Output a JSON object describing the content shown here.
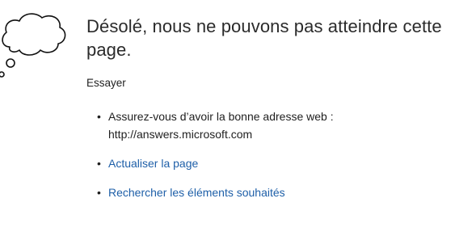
{
  "error": {
    "title": "Désolé, nous ne pouvons pas atteindre cette page.",
    "try_label": "Essayer",
    "suggestions": [
      {
        "text": "Assurez-vous d’avoir la bonne adresse web :",
        "url": "http://answers.microsoft.com"
      },
      {
        "link": "Actualiser la page"
      },
      {
        "link": "Rechercher les éléments souhaités"
      }
    ]
  },
  "icons": {
    "illustration": "thought-cloud-icon"
  },
  "colors": {
    "link": "#1e5fa8",
    "text": "#1f1f1f",
    "heading": "#2b2b2b"
  }
}
